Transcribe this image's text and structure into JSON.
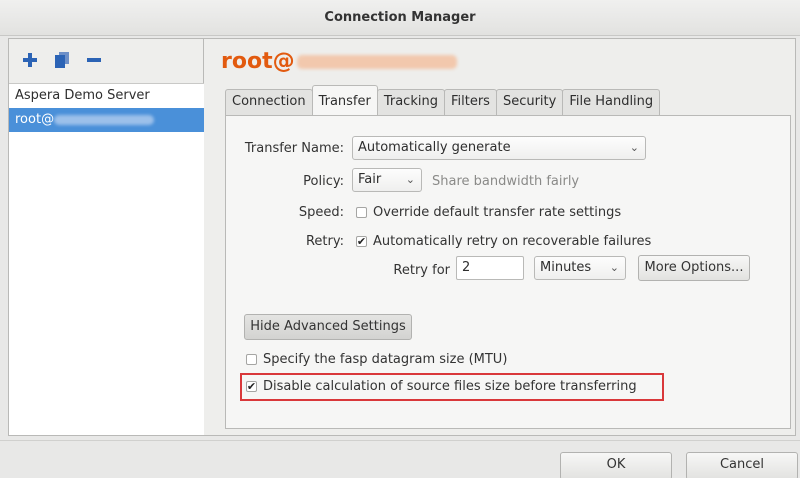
{
  "window": {
    "title": "Connection Manager"
  },
  "sidebar": {
    "toolbar": {
      "add": "add-icon",
      "duplicate": "duplicate-icon",
      "remove": "remove-icon"
    },
    "servers": [
      {
        "label": "Aspera Demo Server",
        "selected": false
      },
      {
        "label": "root@",
        "selected": true
      }
    ]
  },
  "main": {
    "host_prefix": "root@",
    "tabs": [
      "Connection",
      "Transfer",
      "Tracking",
      "Filters",
      "Security",
      "File Handling"
    ],
    "active_tab": "Transfer",
    "transfer_name": {
      "label": "Transfer Name:",
      "value": "Automatically generate"
    },
    "policy": {
      "label": "Policy:",
      "value": "Fair",
      "hint": "Share bandwidth fairly"
    },
    "speed": {
      "label": "Speed:",
      "checkbox_label": "Override default transfer rate settings",
      "checked": false
    },
    "retry": {
      "label": "Retry:",
      "checkbox_label": "Automatically retry on recoverable failures",
      "checked": true,
      "retry_for_label": "Retry for",
      "retry_for_value": "2",
      "unit": "Minutes",
      "more_options": "More Options..."
    },
    "advanced_button": "Hide Advanced Settings",
    "mtu": {
      "label": "Specify the fasp datagram size (MTU)",
      "checked": false
    },
    "disable_calc": {
      "label": "Disable calculation of source files size before transferring",
      "checked": true
    }
  },
  "footer": {
    "ok": "OK",
    "cancel": "Cancel"
  },
  "colors": {
    "host_title": "#e25a0f",
    "selection": "#4a90d9",
    "highlight": "#d9383a"
  }
}
